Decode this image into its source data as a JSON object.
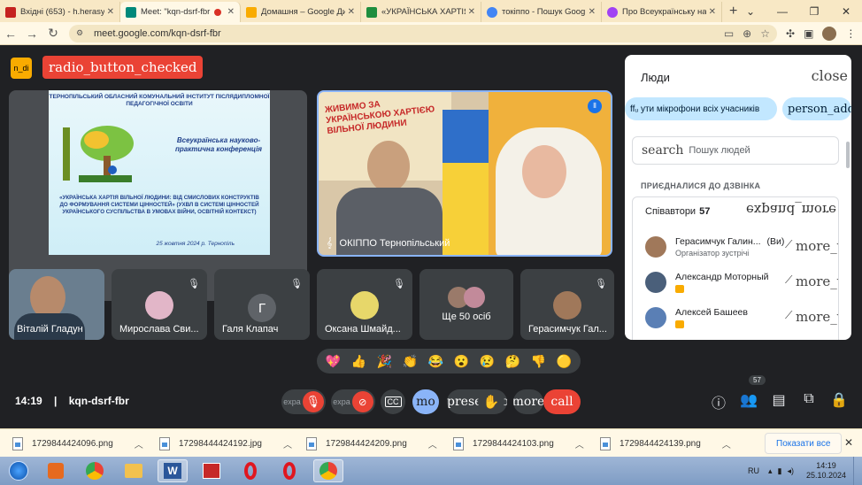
{
  "browser": {
    "tabs": [
      {
        "title": "Вхідні (653) - h.herasym",
        "favicon_color": "#c5221f",
        "active": false
      },
      {
        "title": "Meet: \"kqn-dsrf-fbr",
        "favicon_color": "#00897b",
        "active": true,
        "recording": true
      },
      {
        "title": "Домашня – Google Ди",
        "favicon_color": "#f9ab00",
        "active": false
      },
      {
        "title": "«УКРАЇНСЬКА ХАРТІЯ В",
        "favicon_color": "#1e8e3e",
        "active": false
      },
      {
        "title": "токіппо - Пошук Goog",
        "favicon_color": "#4285f4",
        "active": false
      },
      {
        "title": "Про Всеукраїнську нау",
        "favicon_color": "#a142f4",
        "active": false
      }
    ],
    "url": "meet.google.com/kqn-dsrf-fbr"
  },
  "meet": {
    "top_left_badge": "n_di",
    "recording_chip": "radio_button_checked",
    "slide": {
      "header": "ТЕРНОПІЛЬСЬКИЙ ОБЛАСНИЙ КОМУНАЛЬНИЙ ІНСТИТУТ ПІСЛЯДИПЛОМНОЇ ПЕДАГОГІЧНОЇ ОСВІТИ",
      "conference": "Всеукраїнська науково-практична конференція",
      "body": "«УКРАЇНСЬКА ХАРТІЯ ВІЛЬНОЇ ЛЮДИНИ: ВІД СМИСЛОВИХ КОНСТРУКТІВ ДО ФОРМУВАННЯ СИСТЕМИ ЦІННОСТЕЙ» (УХВЛ В СИСТЕМІ ЦІННОСТЕЙ УКРАЇНСЬКОГО СУСПІЛЬСТВА В УМОВАХ ВІЙНИ, ОСВІТНІЙ КОНТЕКСТ)",
      "date": "25 жовтня 2024 р. Тернопіль"
    },
    "speaker_tile": {
      "name": "ОКІППО Тернопільський",
      "banner": "ЖИВИМО ЗА УКРАЇНСЬКОЮ ХАРТІЄЮ ВІЛЬНОЇ ЛЮДИНИ"
    },
    "participants": [
      {
        "name": "Віталій Гладун"
      },
      {
        "name": "Мирослава Сви..."
      },
      {
        "name": "Галя Клапач",
        "letter": "Г"
      },
      {
        "name": "Оксана Шмайд..."
      },
      {
        "name": "Ще 50 осіб"
      },
      {
        "name": "Герасимчук Гал..."
      }
    ],
    "reactions": [
      "💖",
      "👍",
      "🎉",
      "👏",
      "😂",
      "😮",
      "😢",
      "🤔",
      "👎",
      "🟡"
    ],
    "time": "14:19",
    "meeting_code": "kqn-dsrf-fbr",
    "controls": {
      "expand_1": "expa",
      "expand_2": "expa",
      "mo": "mo",
      "present": "preseⅡ_to",
      "more": "more",
      "call": "call"
    },
    "people_count": "57"
  },
  "panel": {
    "title": "Люди",
    "close": "close",
    "mute_all": "ffᵤ ути мікрофони всіх учасників",
    "person_add": "person_add",
    "search_icon": "search",
    "search_placeholder": "Пошук людей",
    "section_label": "ПРИЄДНАЛИСЯ ДО ДЗВІНКА",
    "group_name": "Співавтори",
    "group_count": "57",
    "group_toggle": "expand_more",
    "more_label": "more_ver",
    "people": [
      {
        "name": "Герасимчук Галин...",
        "suffix": "(Ви)",
        "role": "Організатор зустрічі",
        "avatar_color": "#a0785a"
      },
      {
        "name": "Александр Моторный",
        "role": "",
        "avatar_color": "#4a5f7a"
      },
      {
        "name": "Алексей Башеев",
        "role": "",
        "avatar_color": "#5a7fb5"
      }
    ]
  },
  "downloads": {
    "files": [
      "1729844424096.png",
      "17298444424192.jpg",
      "1729844424209.png",
      "1729844424103.png",
      "1729844424139.png"
    ],
    "show_all": "Показати все"
  },
  "taskbar": {
    "lang": "RU",
    "time": "14:19",
    "date": "25.10.2024"
  }
}
